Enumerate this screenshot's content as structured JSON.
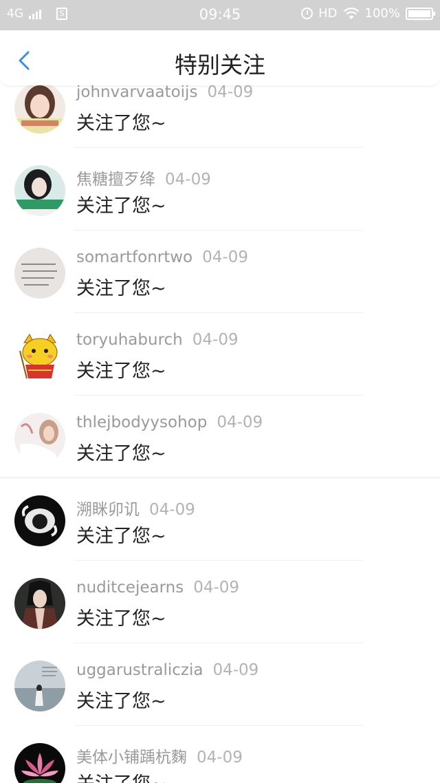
{
  "status_bar": {
    "network": "4G",
    "sim_label": "S",
    "time": "09:45",
    "hd": "HD",
    "battery": "100%"
  },
  "nav": {
    "title": "特别关注"
  },
  "list": {
    "items": [
      {
        "name": "johnvarvaatoijs",
        "date": "04-09",
        "message": "关注了您~"
      },
      {
        "name": "焦糖擅歹绛",
        "date": "04-09",
        "message": "关注了您~"
      },
      {
        "name": "somartfonrtwo",
        "date": "04-09",
        "message": "关注了您~"
      },
      {
        "name": "toryuhaburch",
        "date": "04-09",
        "message": "关注了您~"
      },
      {
        "name": "thlejbodyysohop",
        "date": "04-09",
        "message": "关注了您~"
      },
      {
        "name": "溯眯卯讥",
        "date": "04-09",
        "message": "关注了您~"
      },
      {
        "name": "nuditcejearns",
        "date": "04-09",
        "message": "关注了您~"
      },
      {
        "name": "uggarustraliczia",
        "date": "04-09",
        "message": "关注了您~"
      },
      {
        "name": "美体小铺踽杭麴",
        "date": "04-09",
        "message": "关注了您~"
      }
    ]
  },
  "colors": {
    "status_bar_bg": "#d2d2d2",
    "accent": "#3a8ee6",
    "text_primary": "#222222",
    "text_secondary": "#9a9a9a"
  }
}
